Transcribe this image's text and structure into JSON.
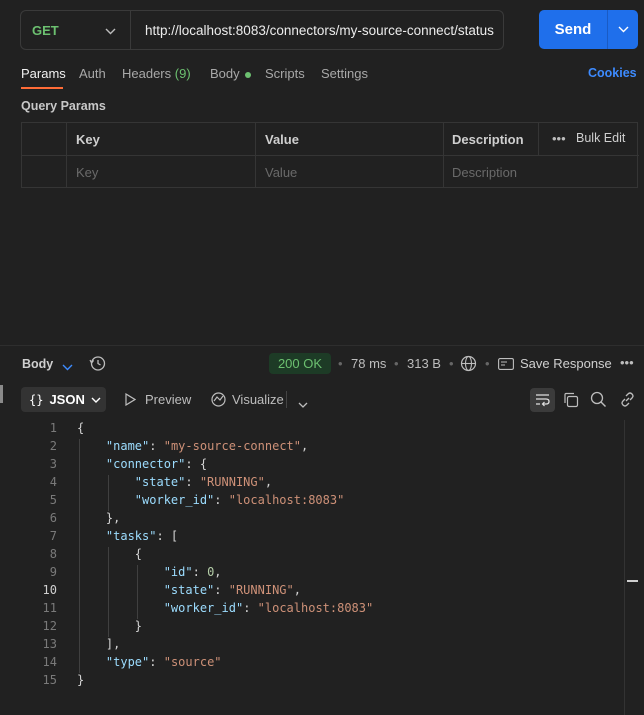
{
  "request": {
    "method": "GET",
    "url": "http://localhost:8083/connectors/my-source-connect/status",
    "send_label": "Send"
  },
  "tabs": [
    {
      "label": "Params"
    },
    {
      "label": "Auth"
    },
    {
      "label": "Headers",
      "count": "(9)"
    },
    {
      "label": "Body"
    },
    {
      "label": "Scripts"
    },
    {
      "label": "Settings"
    }
  ],
  "cookies_label": "Cookies",
  "query_params": {
    "title": "Query Params",
    "headers": {
      "key": "Key",
      "value": "Value",
      "description": "Description",
      "bulk_edit": "Bulk Edit"
    },
    "placeholders": {
      "key": "Key",
      "value": "Value",
      "description": "Description"
    }
  },
  "response": {
    "section_label": "Body",
    "status": "200 OK",
    "time": "78 ms",
    "size": "313 B",
    "save_label": "Save Response",
    "format": "JSON",
    "preview_label": "Preview",
    "visualize_label": "Visualize",
    "current_line": 10,
    "lines": [
      "{",
      "    \"name\": \"my-source-connect\",",
      "    \"connector\": {",
      "        \"state\": \"RUNNING\",",
      "        \"worker_id\": \"localhost:8083\"",
      "    },",
      "    \"tasks\": [",
      "        {",
      "            \"id\": 0,",
      "            \"state\": \"RUNNING\",",
      "            \"worker_id\": \"localhost:8083\"",
      "        }",
      "    ],",
      "    \"type\": \"source\"",
      "}"
    ]
  },
  "colors": {
    "accent": "#1f6feb",
    "method_get": "#6cc070",
    "status_ok": "#6cc070",
    "active_tab": "#ff6c37"
  }
}
